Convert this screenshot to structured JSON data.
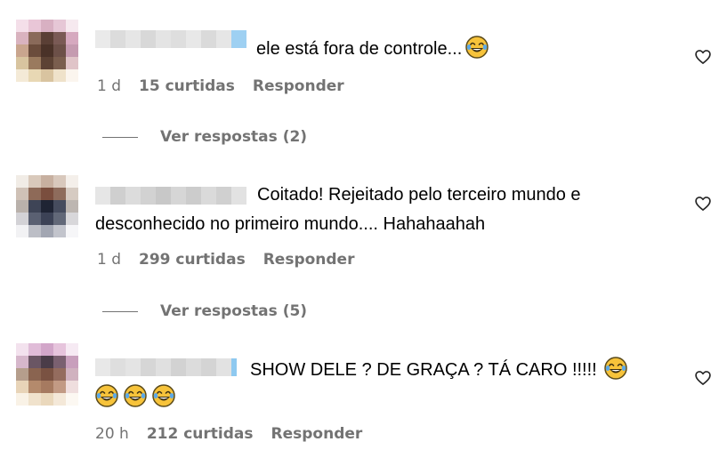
{
  "comments": [
    {
      "text": "ele está fora de controle...",
      "time": "1 d",
      "likes": "15 curtidas",
      "reply": "Responder",
      "replies": "Ver respostas (2)"
    },
    {
      "text_line1": "Coitado! Rejeitado pelo terceiro mundo e",
      "text_line2": "desconhecido no primeiro mundo.... Hahahaahah",
      "time": "1 d",
      "likes": "299 curtidas",
      "reply": "Responder",
      "replies": "Ver respostas (5)"
    },
    {
      "text": "SHOW DELE ? DE GRAÇA ? TÁ CARO !!!!!",
      "time": "20 h",
      "likes": "212 curtidas",
      "reply": "Responder"
    }
  ],
  "icons": {
    "like": "heart-outline-icon",
    "emoji": "face-with-tears-of-joy-icon"
  },
  "colors": {
    "meta": "#737373",
    "text": "#000000",
    "emoji_face": "#f7c33a"
  }
}
